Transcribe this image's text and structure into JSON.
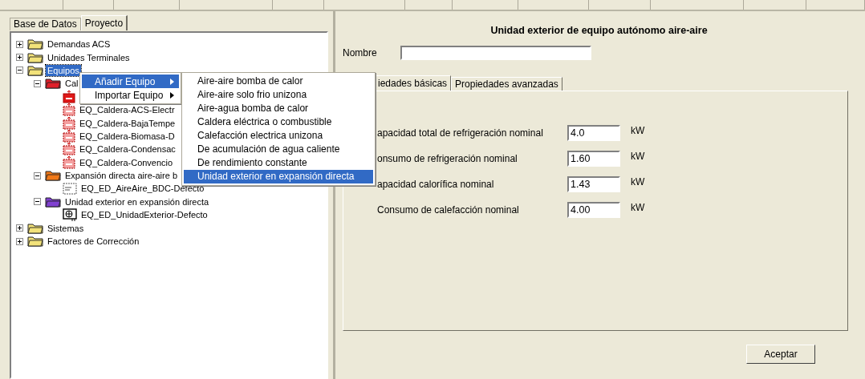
{
  "left_tabs": [
    {
      "label": "Base de Datos",
      "selected": false
    },
    {
      "label": "Proyecto",
      "selected": true
    }
  ],
  "tree": [
    {
      "label": "Demandas ACS",
      "kind": "folder",
      "color": "#f2e27a",
      "expanded": false,
      "selected": false
    },
    {
      "label": "Unidades Terminales",
      "kind": "folder",
      "color": "#f2e27a",
      "expanded": false,
      "selected": false
    },
    {
      "label": "Equipos",
      "kind": "folder",
      "color": "#f2e27a",
      "expanded": true,
      "selected": true,
      "children": [
        {
          "label": "Cal",
          "kind": "folder",
          "color": "#e0202a",
          "expanded": true,
          "selected": false,
          "children": [
            {
              "kind": "boiler-solid"
            },
            {
              "label": "EQ_Caldera-ACS-Electr",
              "kind": "boiler"
            },
            {
              "label": "EQ_Caldera-BajaTempe",
              "kind": "boiler"
            },
            {
              "label": "EQ_Caldera-Biomasa-D",
              "kind": "boiler"
            },
            {
              "label": "EQ_Caldera-Condensac",
              "kind": "boiler"
            },
            {
              "label": "EQ_Caldera-Convencio",
              "kind": "boiler"
            }
          ]
        },
        {
          "label": "Expansión directa aire-aire b",
          "kind": "folder",
          "color": "#f07818",
          "expanded": true,
          "selected": false,
          "children": [
            {
              "label": "EQ_ED_AireAire_BDC-Defecto",
              "kind": "split"
            }
          ]
        },
        {
          "label": "Unidad exterior en expansión directa",
          "kind": "folder",
          "color": "#8040d0",
          "expanded": true,
          "selected": false,
          "children": [
            {
              "label": "EQ_ED_UnidadExterior-Defecto",
              "kind": "outdoor"
            }
          ]
        }
      ]
    },
    {
      "label": "Sistemas",
      "kind": "folder",
      "color": "#f2e27a",
      "expanded": false,
      "selected": false
    },
    {
      "label": "Factores de Corrección",
      "kind": "folder",
      "color": "#f2e27a",
      "expanded": false,
      "selected": false
    }
  ],
  "context_menu": [
    {
      "label": "Añadir Equipo",
      "selected": true
    },
    {
      "label": "Importar Equipo",
      "selected": false
    }
  ],
  "submenu": [
    {
      "label": "Aire-aire bomba de calor",
      "selected": false
    },
    {
      "label": "Aire-aire solo frio unizona",
      "selected": false
    },
    {
      "label": "Aire-agua bomba de calor",
      "selected": false
    },
    {
      "label": "Caldera eléctrica o combustible",
      "selected": false
    },
    {
      "label": "Calefacción electrica unizona",
      "selected": false
    },
    {
      "label": "De acumulación de agua caliente",
      "selected": false
    },
    {
      "label": "De rendimiento constante",
      "selected": false
    },
    {
      "label": "Unidad exterior en expansión directa",
      "selected": true
    }
  ],
  "form": {
    "title": "Unidad exterior de equipo autónomo aire-aire",
    "name_label": "Nombre",
    "tabs": [
      {
        "label": "iedades básicas",
        "selected": true
      },
      {
        "label": "Propiedades avanzadas",
        "selected": false
      }
    ],
    "properties": [
      {
        "label": "apacidad total de refrigeración nominal",
        "value": "4.0",
        "unit": "kW"
      },
      {
        "label": "onsumo de refrigeración nominal",
        "value": "1.60",
        "unit": "kW"
      },
      {
        "label": "apacidad calorífica nominal",
        "value": "1.43",
        "unit": "kW"
      },
      {
        "label": "Consumo de calefacción nominal",
        "value": "4.00",
        "unit": "kW"
      }
    ],
    "buttons": [
      {
        "label": "Aceptar"
      }
    ]
  }
}
